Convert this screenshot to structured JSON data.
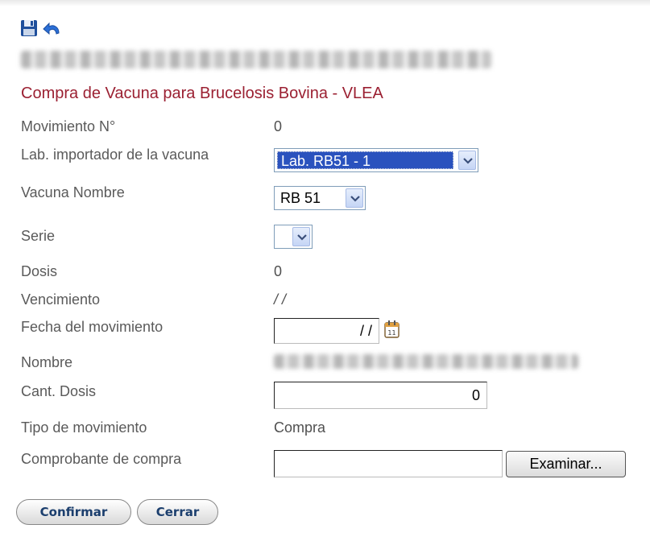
{
  "toolbar": {
    "save_icon": "save-disk-icon",
    "undo_icon": "undo-arrow-icon"
  },
  "page": {
    "title": "Compra de Vacuna para Brucelosis Bovina - VLEA"
  },
  "form": {
    "movimiento": {
      "label": "Movimiento N°",
      "value": "0"
    },
    "lab": {
      "label": "Lab. importador de la vacuna",
      "selected": "Lab. RB51 - 1"
    },
    "vacuna": {
      "label": "Vacuna Nombre",
      "selected": "RB 51"
    },
    "serie": {
      "label": "Serie",
      "selected": ""
    },
    "dosis": {
      "label": "Dosis",
      "value": "0"
    },
    "vencimiento": {
      "label": "Vencimiento",
      "value": "/ /"
    },
    "fecha": {
      "label": "Fecha del movimiento",
      "value": "/ /"
    },
    "nombre": {
      "label": "Nombre"
    },
    "cant_dosis": {
      "label": "Cant. Dosis",
      "value": "0"
    },
    "tipo": {
      "label": "Tipo de movimiento",
      "value": "Compra"
    },
    "comprobante": {
      "label": "Comprobante de compra",
      "value": "",
      "browse_label": "Examinar..."
    }
  },
  "actions": {
    "confirm_label": "Confirmar",
    "close_label": "Cerrar"
  },
  "colors": {
    "title": "#9b2032",
    "selection": "#2a52be",
    "button_text": "#1c3f6e"
  }
}
